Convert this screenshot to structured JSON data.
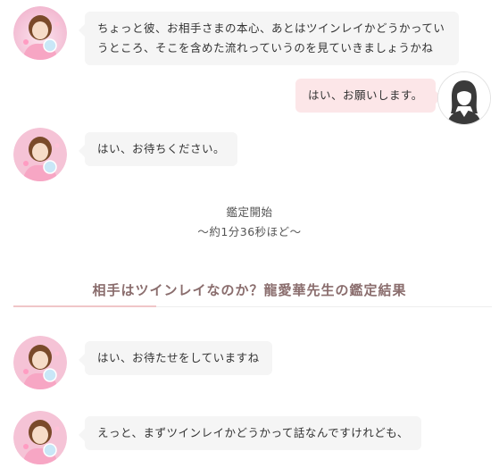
{
  "messages": [
    {
      "speaker": "reader",
      "text": "ちょっと彼、お相手さまの本心、あとはツインレイかどうかっていうところ、そこを含めた流れっていうのを見ていきましょうかね"
    },
    {
      "speaker": "user",
      "text": "はい、お願いします。"
    },
    {
      "speaker": "reader",
      "text": "はい、お待ちください。"
    },
    {
      "speaker": "reader",
      "text": "はい、お待たせをしていますね"
    },
    {
      "speaker": "reader",
      "text": "えっと、まずツインレイかどうかって話なんですけれども、"
    }
  ],
  "appraisal": {
    "start_label": "鑑定開始",
    "duration_label": "〜約1分36秒ほど〜"
  },
  "section": {
    "title": "相手はツインレイなのか？龍愛華先生の鑑定結果"
  },
  "colors": {
    "reader_bubble": "#f5f5f5",
    "user_bubble": "#fce6e8",
    "title": "#8a6d6d"
  }
}
